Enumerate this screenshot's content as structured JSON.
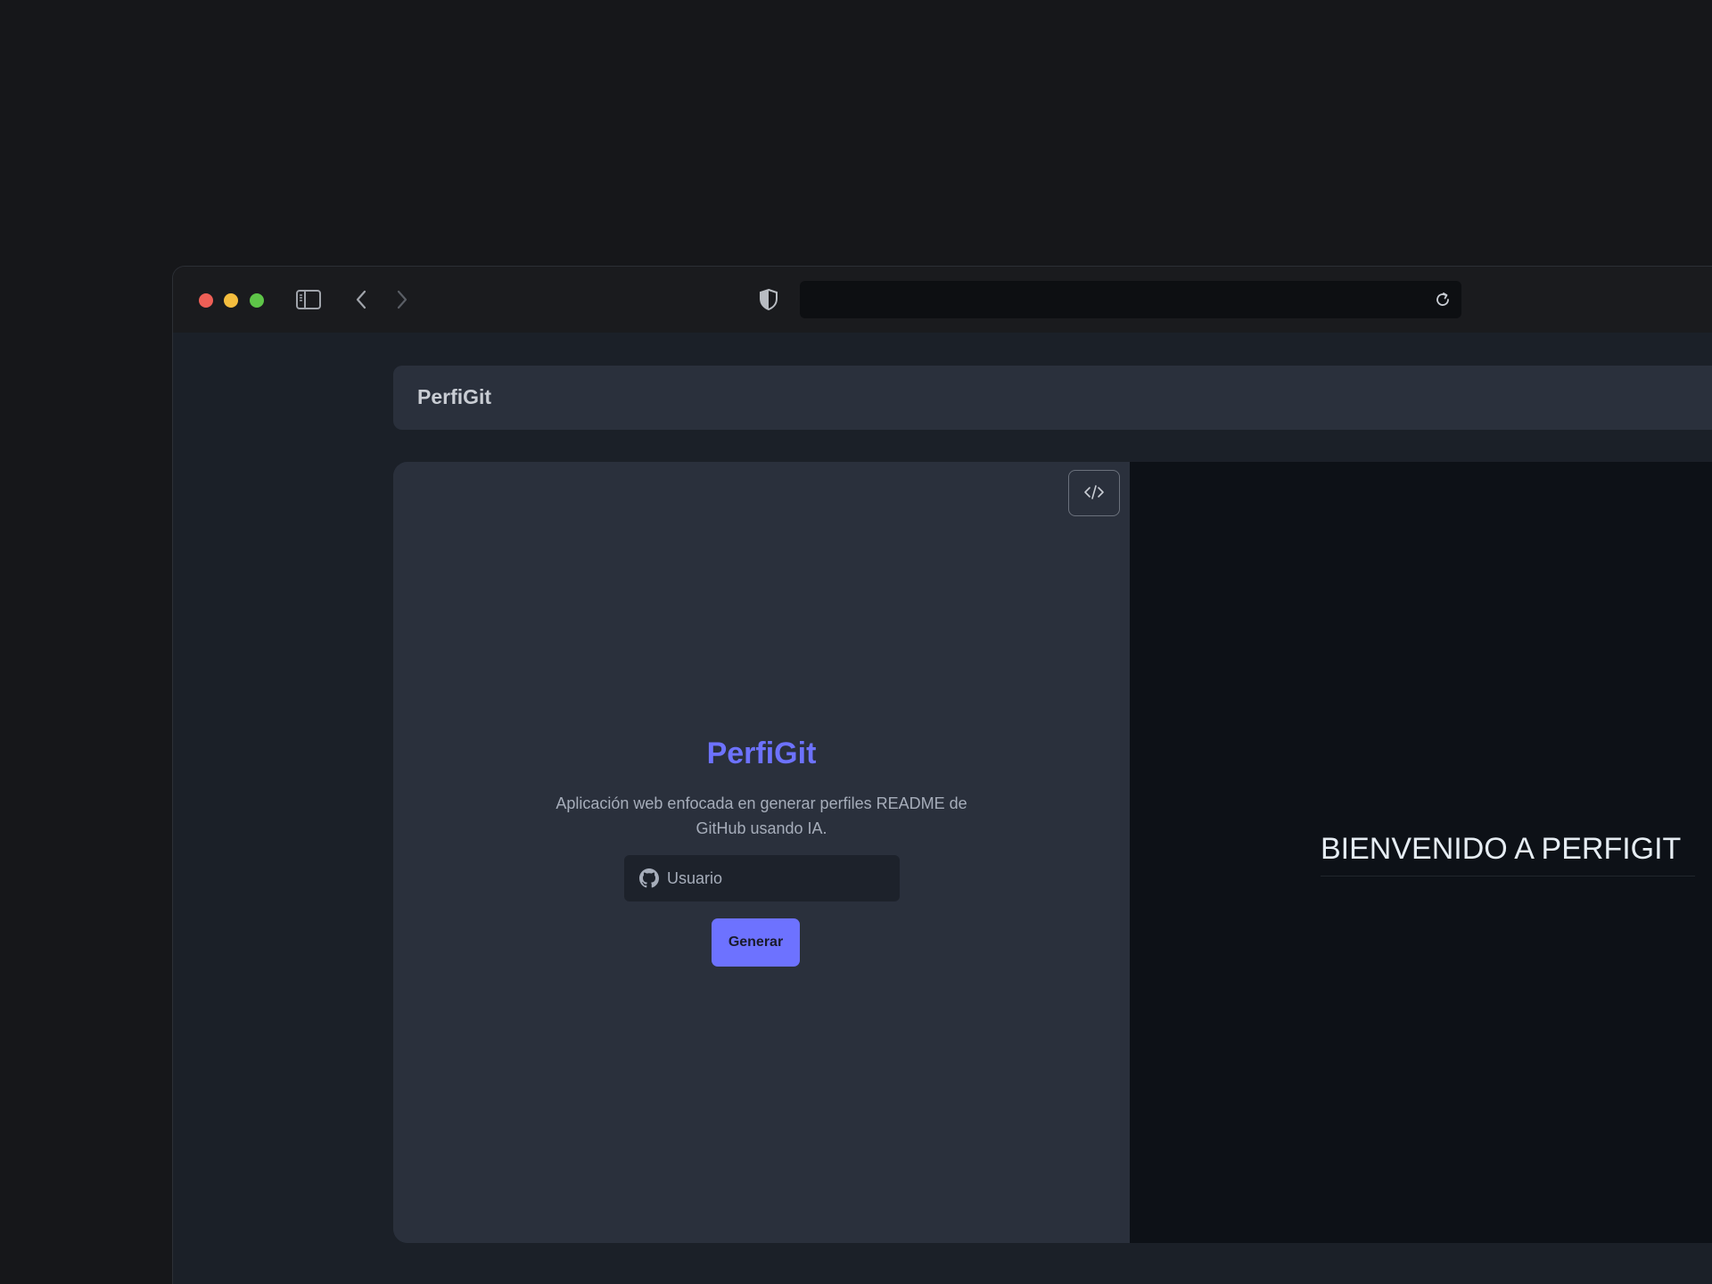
{
  "browser": {
    "traffic_lights": [
      "close",
      "minimize",
      "zoom"
    ],
    "icons": {
      "sidebar": "sidebar-icon",
      "back": "chevron-left-icon",
      "forward": "chevron-right-icon",
      "shield": "shield-icon",
      "reload": "reload-icon"
    },
    "address": ""
  },
  "header": {
    "brand": "PerfiGit"
  },
  "form": {
    "title": "PerfiGit",
    "description": "Aplicación web enfocada en generar perfiles README de GitHub usando IA.",
    "username_placeholder": "Usuario",
    "username_value": "",
    "generate_label": "Generar",
    "code_toggle_icon": "code-icon",
    "github_icon": "github-icon"
  },
  "preview": {
    "heading": "BIENVENIDO A PERFIGIT"
  },
  "colors": {
    "accent": "#6d72ff",
    "panel": "#2a303c",
    "preview_bg": "#0d1117",
    "page_bg": "#1b2028"
  }
}
